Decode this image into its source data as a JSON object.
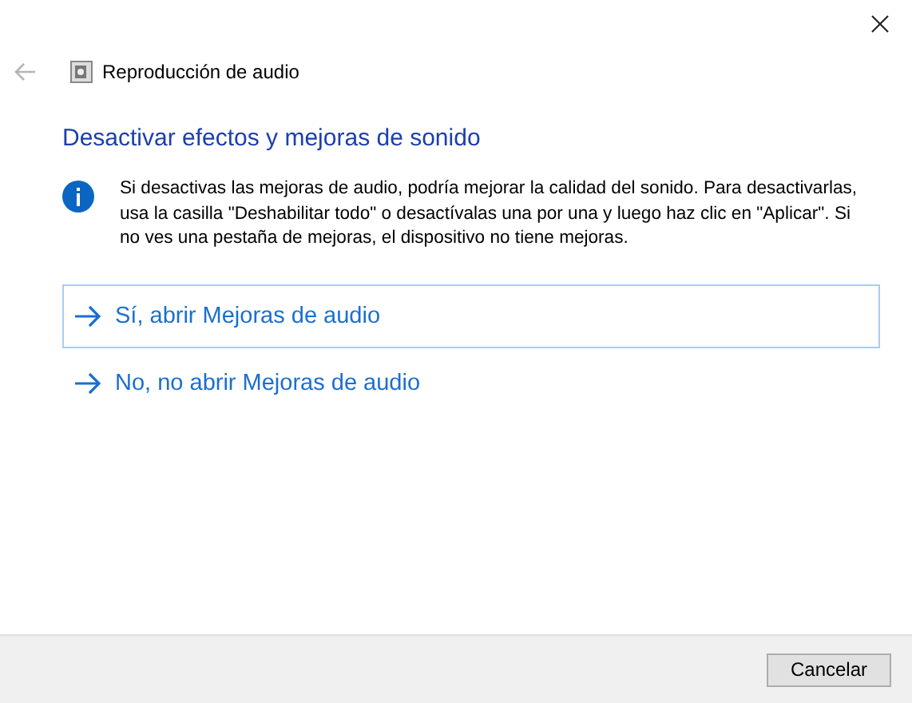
{
  "window": {
    "title": "Reproducción de audio"
  },
  "heading": "Desactivar efectos y mejoras de sonido",
  "info": "Si desactivas las mejoras de audio, podría mejorar la calidad del sonido. Para desactivarlas, usa la casilla \"Deshabilitar todo\" o desactívalas una por una y luego haz clic en \"Aplicar\". Si no ves una pestaña de mejoras, el dispositivo no tiene mejoras.",
  "options": [
    {
      "label": "Sí, abrir Mejoras de audio",
      "focused": true
    },
    {
      "label": "No, no abrir Mejoras de audio",
      "focused": false
    }
  ],
  "buttons": [
    "Cancelar"
  ]
}
